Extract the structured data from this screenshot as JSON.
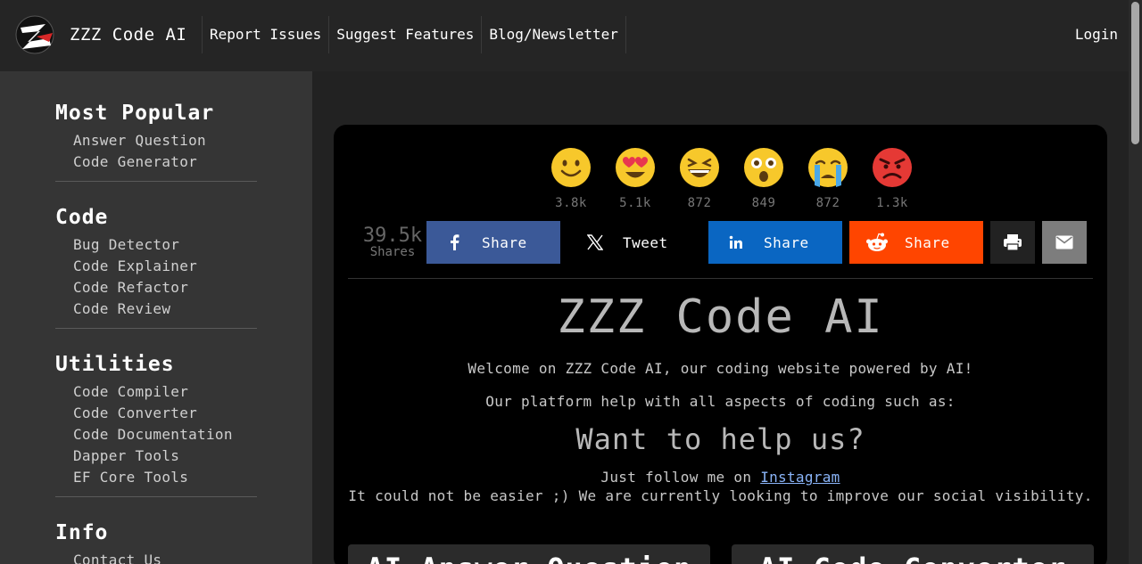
{
  "header": {
    "brand": "ZZZ Code AI",
    "nav": [
      "Report Issues",
      "Suggest Features",
      "Blog/Newsletter"
    ],
    "login": "Login"
  },
  "sidebar": {
    "sections": [
      {
        "title": "Most Popular",
        "items": [
          "Answer Question",
          "Code Generator"
        ]
      },
      {
        "title": "Code",
        "items": [
          "Bug Detector",
          "Code Explainer",
          "Code Refactor",
          "Code Review"
        ]
      },
      {
        "title": "Utilities",
        "items": [
          "Code Compiler",
          "Code Converter",
          "Code Documentation",
          "Dapper Tools",
          "EF Core Tools"
        ]
      },
      {
        "title": "Info",
        "items": [
          "Contact Us"
        ]
      }
    ]
  },
  "reactions": [
    {
      "icon": "smile-emoji-icon",
      "count": "3.8k"
    },
    {
      "icon": "heart-eyes-emoji-icon",
      "count": "5.1k"
    },
    {
      "icon": "laughing-emoji-icon",
      "count": "872"
    },
    {
      "icon": "astonished-emoji-icon",
      "count": "849"
    },
    {
      "icon": "crying-emoji-icon",
      "count": "872"
    },
    {
      "icon": "angry-emoji-icon",
      "count": "1.3k"
    }
  ],
  "shares": {
    "total": "39.5k",
    "label": "Shares",
    "facebook": "Share",
    "twitter": "Tweet",
    "linkedin": "Share",
    "reddit": "Share"
  },
  "hero": {
    "title": "ZZZ Code AI",
    "welcome": "Welcome on ZZZ Code AI, our coding website powered by AI!",
    "platform": "Our platform help with all aspects of coding such as:",
    "help_heading": "Want to help us?",
    "follow_prefix": "Just follow me on ",
    "follow_link": "Instagram",
    "easier": "It could not be easier ;) We are currently looking to improve our social visibility."
  },
  "tiles": [
    "AI Answer Question",
    "AI Code Converter"
  ],
  "colors": {
    "facebook": "#3b5998",
    "linkedin": "#0a66c2",
    "reddit": "#ff4500",
    "email": "#7d7d7d",
    "sidebar_bg": "#353535",
    "topbar_bg": "#252525"
  }
}
